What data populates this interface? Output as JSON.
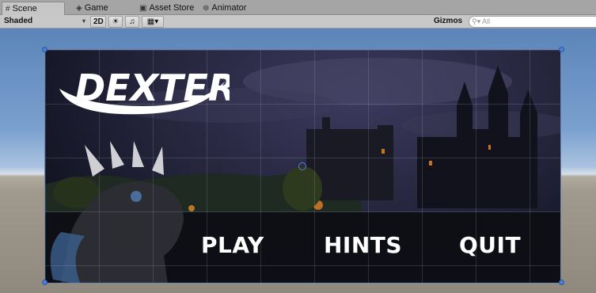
{
  "tabs": [
    {
      "label": "Scene",
      "icon": "scene-icon"
    },
    {
      "label": "Game",
      "icon": "game-icon"
    },
    {
      "label": "Asset Store",
      "icon": "asset-store-icon"
    },
    {
      "label": "Animator",
      "icon": "animator-icon"
    }
  ],
  "toolbar": {
    "shading_mode": "Shaded",
    "mode_2d": "2D",
    "gizmos_label": "Gizmos",
    "search_placeholder": "All"
  },
  "game_ui": {
    "logo_text": "DEXTER",
    "buttons": {
      "play": "PLAY",
      "hints": "HINTS",
      "quit": "QUIT"
    }
  },
  "colors": {
    "handle": "#4d7fd8",
    "menu_text": "#ffffff",
    "sky_top": "#5b85b8",
    "ground": "#9f998e"
  }
}
